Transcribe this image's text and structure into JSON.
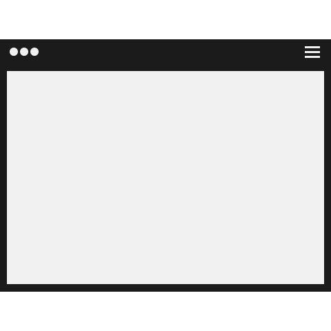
{
  "window": {
    "frame_color": "#1b1b1b",
    "content_color": "#f1f1f1",
    "titlebar": {
      "controls": [
        {
          "icon": "window-dot-icon"
        },
        {
          "icon": "window-dot-icon"
        },
        {
          "icon": "window-dot-icon"
        }
      ],
      "menu_icon": "hamburger-menu-icon"
    }
  }
}
